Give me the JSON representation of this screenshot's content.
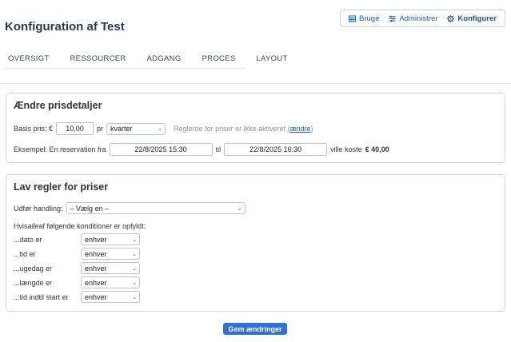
{
  "page": {
    "title": "Konfiguration af Test"
  },
  "topnav": {
    "items": [
      {
        "label": "Bruge",
        "icon": "calendar-grid-icon"
      },
      {
        "label": "Administrer",
        "icon": "sliders-icon"
      },
      {
        "label": "Konfigurer",
        "icon": "gear-icon",
        "active": true
      }
    ]
  },
  "tabs": [
    "OVERSIGT",
    "RESSOURCER",
    "ADGANG",
    "PROCES",
    "LAYOUT"
  ],
  "prices": {
    "heading": "Ændre prisdetaljer",
    "base_label": "Basis pris: €",
    "base_value": "10,00",
    "per_label": "pr",
    "unit_selected": "kvarter",
    "rules_notice": "Reglerne for priser er ikke aktiveret (",
    "rules_link": "ændre",
    "rules_notice_end": ")",
    "example_label": "Eksempel: En reservation fra",
    "from_value": "22/8/2025 15:30",
    "to_label": "til",
    "to_value": "22/8/2025 16:30",
    "cost_label": "ville koste",
    "cost_value": "€ 40,00"
  },
  "rules": {
    "heading": "Lav regler for priser",
    "action_label": "Udfør handling:",
    "action_selected": "– Vælg en –",
    "condition_intro_pre": "Hvis ",
    "condition_intro_em": "alle",
    "condition_intro_post": " af følgende konditioner er opfyldt:",
    "conditions": [
      {
        "label": "...dato er",
        "value": "enhver"
      },
      {
        "label": "...tid er",
        "value": "enhver"
      },
      {
        "label": "...ugedag er",
        "value": "enhver"
      },
      {
        "label": "...længde er",
        "value": "enhver"
      },
      {
        "label": "...tid indtil start er",
        "value": "enhver"
      }
    ]
  },
  "save_label": "Gem ændringer",
  "colors": {
    "accent": "#2f6fd6",
    "link": "#1f5fa8",
    "border": "#cfd6dd"
  }
}
